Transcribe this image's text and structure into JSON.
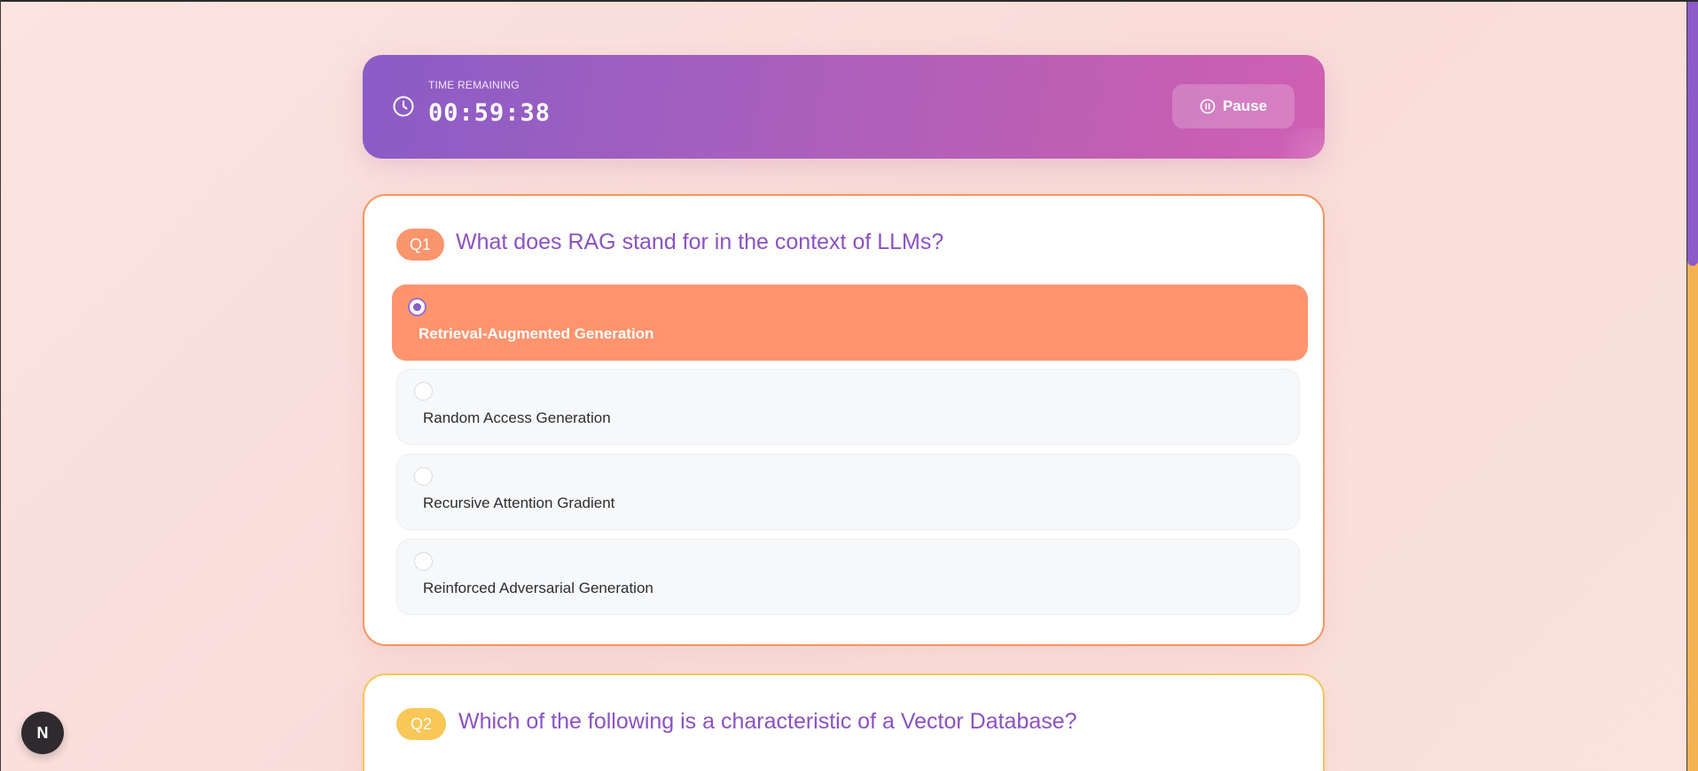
{
  "timer": {
    "label": "TIME REMAINING",
    "value": "00:59:38",
    "pause_label": "Pause"
  },
  "questions": [
    {
      "badge": "Q1",
      "text": "What does RAG stand for in the context of LLMs?",
      "options": [
        {
          "label": "Retrieval-Augmented Generation",
          "selected": true
        },
        {
          "label": "Random Access Generation",
          "selected": false
        },
        {
          "label": "Recursive Attention Gradient",
          "selected": false
        },
        {
          "label": "Reinforced Adversarial Generation",
          "selected": false
        }
      ]
    },
    {
      "badge": "Q2",
      "text": "Which of the following is a characteristic of a Vector Database?"
    }
  ],
  "dev_badge": {
    "label": "N"
  },
  "colors": {
    "accent_purple": "#8c52c1",
    "selected_option": "#ff946f",
    "q1_border": "#f7945f",
    "q2_border": "#f8c455"
  }
}
